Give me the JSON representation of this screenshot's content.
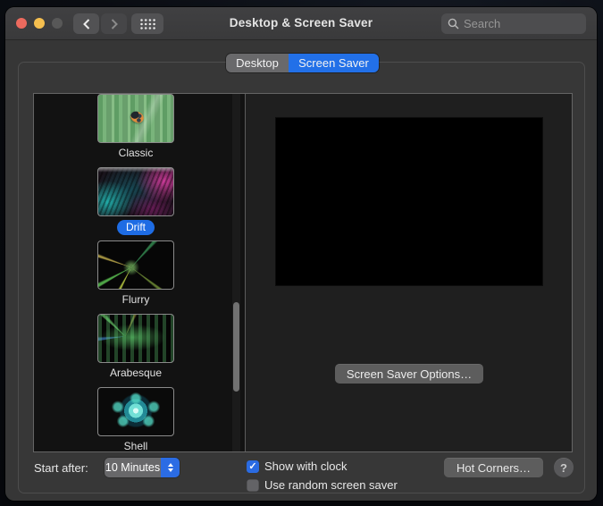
{
  "window": {
    "title": "Desktop & Screen Saver"
  },
  "titlebar": {
    "search_placeholder": "Search",
    "icons": {
      "close": "red-circle",
      "minimize": "yellow-circle",
      "zoom_disabled": "gray-circle",
      "back": "chevron-left",
      "forward": "chevron-right",
      "show_all": "dot-grid",
      "search": "magnifier"
    }
  },
  "tabs": [
    {
      "label": "Desktop",
      "active": false
    },
    {
      "label": "Screen Saver",
      "active": true
    }
  ],
  "savers": [
    {
      "name": "Classic",
      "selected": false
    },
    {
      "name": "Drift",
      "selected": true
    },
    {
      "name": "Flurry",
      "selected": false
    },
    {
      "name": "Arabesque",
      "selected": false
    },
    {
      "name": "Shell",
      "selected": false
    }
  ],
  "preview": {
    "options_button": "Screen Saver Options…"
  },
  "footer": {
    "start_after_label": "Start after:",
    "start_after_value": "10 Minutes",
    "checkboxes": [
      {
        "label": "Show with clock",
        "checked": true,
        "glyph": "✓"
      },
      {
        "label": "Use random screen saver",
        "checked": false,
        "glyph": ""
      }
    ],
    "hot_corners_label": "Hot Corners…",
    "help_label": "?"
  },
  "colors": {
    "accent_blue": "#2270e8",
    "selection_pill": "#1e6ce4",
    "checkbox_blue": "#2a6be2",
    "window_bg": "#363636",
    "list_bg": "#121212",
    "preview_bg": "#1f1f1f",
    "screen_black": "#000000"
  }
}
